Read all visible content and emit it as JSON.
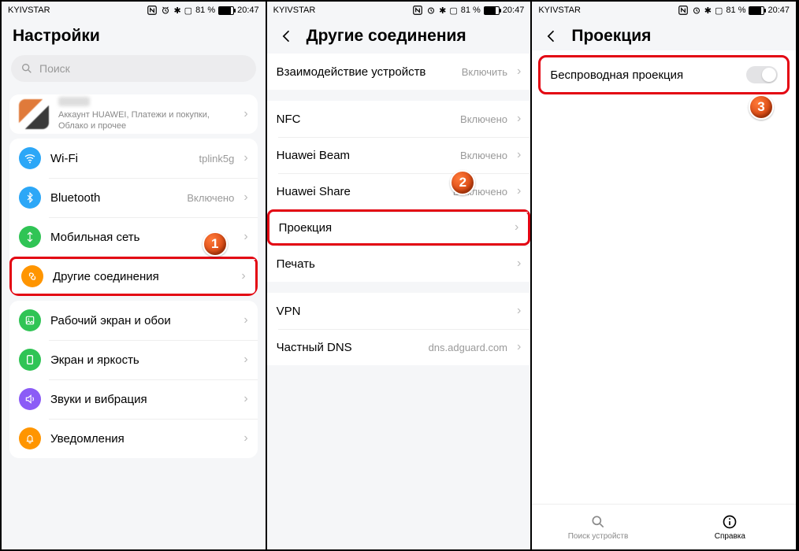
{
  "status": {
    "carrier": "KYIVSTAR",
    "nfc": "N",
    "bt": "✱",
    "batt_text": "81 %",
    "time": "20:47",
    "sig": "▮▮▯"
  },
  "p1": {
    "title": "Настройки",
    "search_placeholder": "Поиск",
    "account_desc": "Аккаунт HUAWEI, Платежи и покупки, Облако и прочее",
    "items": [
      {
        "label": "Wi-Fi",
        "val": "tplink5g",
        "color": "#2ca7f7",
        "glyph": "wifi"
      },
      {
        "label": "Bluetooth",
        "val": "Включено",
        "color": "#2ca7f7",
        "glyph": "bt"
      },
      {
        "label": "Мобильная сеть",
        "val": "",
        "color": "#30c455",
        "glyph": "sim"
      },
      {
        "label": "Другие соединения",
        "val": "",
        "color": "#ff9500",
        "glyph": "link",
        "hl": true
      },
      {
        "label": "Рабочий экран и обои",
        "val": "",
        "color": "#30c455",
        "glyph": "img"
      },
      {
        "label": "Экран и яркость",
        "val": "",
        "color": "#30c455",
        "glyph": "bright"
      },
      {
        "label": "Звуки и вибрация",
        "val": "",
        "color": "#8b5cf6",
        "glyph": "sound"
      },
      {
        "label": "Уведомления",
        "val": "",
        "color": "#ff9500",
        "glyph": "bell"
      }
    ],
    "step": "1"
  },
  "p2": {
    "title": "Другие соединения",
    "groups": [
      [
        {
          "label": "Взаимодействие устройств",
          "val": "Включить"
        }
      ],
      [
        {
          "label": "NFC",
          "val": "Включено"
        },
        {
          "label": "Huawei Beam",
          "val": "Включено"
        },
        {
          "label": "Huawei Share",
          "val": "Выключено"
        },
        {
          "label": "Проекция",
          "val": "",
          "hl": true
        },
        {
          "label": "Печать",
          "val": ""
        }
      ],
      [
        {
          "label": "VPN",
          "val": ""
        },
        {
          "label": "Частный DNS",
          "val": "dns.adguard.com"
        }
      ]
    ],
    "step": "2"
  },
  "p3": {
    "title": "Проекция",
    "item_label": "Беспроводная проекция",
    "step": "3",
    "nav": [
      {
        "label": "Поиск устройств",
        "glyph": "search"
      },
      {
        "label": "Справка",
        "glyph": "info",
        "active": true
      }
    ]
  }
}
